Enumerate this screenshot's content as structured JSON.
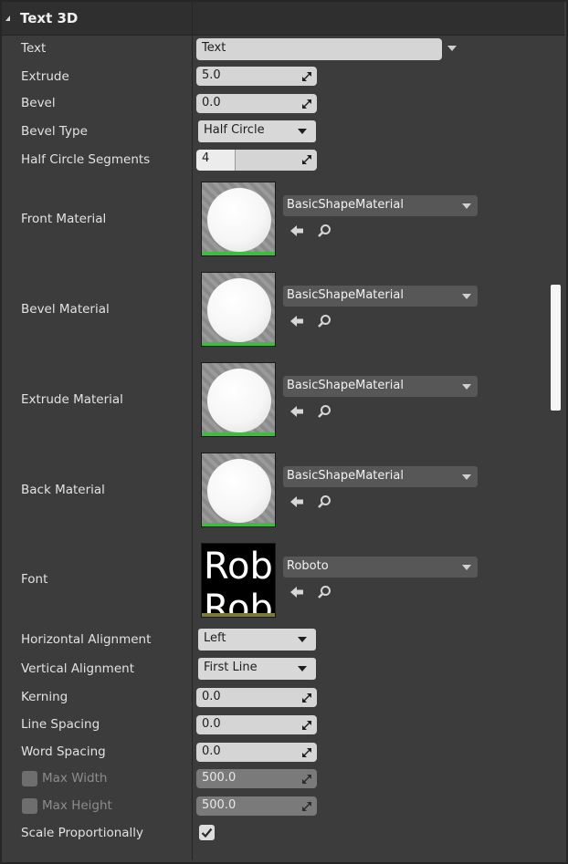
{
  "section": {
    "title": "Text 3D"
  },
  "rows": {
    "text": {
      "label": "Text",
      "value": "Text"
    },
    "extrude": {
      "label": "Extrude",
      "value": "5.0"
    },
    "bevel": {
      "label": "Bevel",
      "value": "0.0"
    },
    "bevel_type": {
      "label": "Bevel Type",
      "value": "Half Circle"
    },
    "half_circle_segments": {
      "label": "Half Circle Segments",
      "value": "4",
      "slider_fraction": 0.32
    },
    "front_material": {
      "label": "Front Material",
      "asset": "BasicShapeMaterial"
    },
    "bevel_material": {
      "label": "Bevel Material",
      "asset": "BasicShapeMaterial"
    },
    "extrude_material": {
      "label": "Extrude Material",
      "asset": "BasicShapeMaterial"
    },
    "back_material": {
      "label": "Back Material",
      "asset": "BasicShapeMaterial"
    },
    "font": {
      "label": "Font",
      "asset": "Roboto",
      "thumb_text": "Rob"
    },
    "horizontal_alignment": {
      "label": "Horizontal Alignment",
      "value": "Left"
    },
    "vertical_alignment": {
      "label": "Vertical Alignment",
      "value": "First Line"
    },
    "kerning": {
      "label": "Kerning",
      "value": "0.0"
    },
    "line_spacing": {
      "label": "Line Spacing",
      "value": "0.0"
    },
    "word_spacing": {
      "label": "Word Spacing",
      "value": "0.0"
    },
    "max_width": {
      "label": "Max Width",
      "value": "500.0",
      "enabled": false
    },
    "max_height": {
      "label": "Max Height",
      "value": "500.0",
      "enabled": false
    },
    "scale_proportionally": {
      "label": "Scale Proportionally",
      "checked": true
    }
  },
  "icons": {
    "use_selected": "arrow-left-icon",
    "browse": "search-icon",
    "drag": "drag-handle-icon",
    "check": "checkmark-icon"
  },
  "colors": {
    "panel_bg": "#3c3c3c",
    "thumbnail_material_bar": "#3fbb3f",
    "thumbnail_font_bar": "#7b7b3a"
  }
}
